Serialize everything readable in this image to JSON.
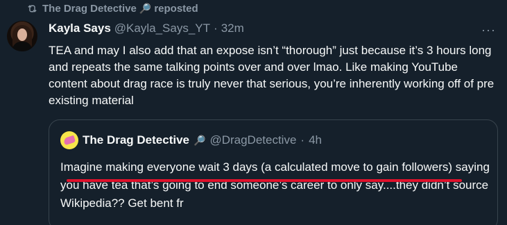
{
  "repost": {
    "reposter": "The Drag Detective",
    "reposter_icon": "magnifier-icon",
    "suffix": "reposted",
    "icon": "repost-icon"
  },
  "tweet": {
    "author": "Kayla Says",
    "handle": "@Kayla_Says_YT",
    "dot": "·",
    "time": "32m",
    "text": "TEA and may I also add that an expose isn’t “thorough” just because it’s 3 hours long and repeats the same talking points over and over lmao. Like making YouTube content about drag race is truly never that serious, you’re inherently working off of pre existing material",
    "more": "···"
  },
  "quote": {
    "author": "The Drag Detective",
    "author_icon": "magnifier-icon",
    "handle": "@DragDetective",
    "dot": "·",
    "time": "4h",
    "text": "Imagine making everyone wait 3 days (a calculated move to gain followers) saying you have tea that’s going to end someone’s career to only say....they didn’t source Wikipedia?? Get bent fr"
  },
  "colors": {
    "background": "#15202b",
    "text": "#f7f9f9",
    "muted": "#8b98a5",
    "border": "#38444d",
    "underline": "#e0112b"
  }
}
